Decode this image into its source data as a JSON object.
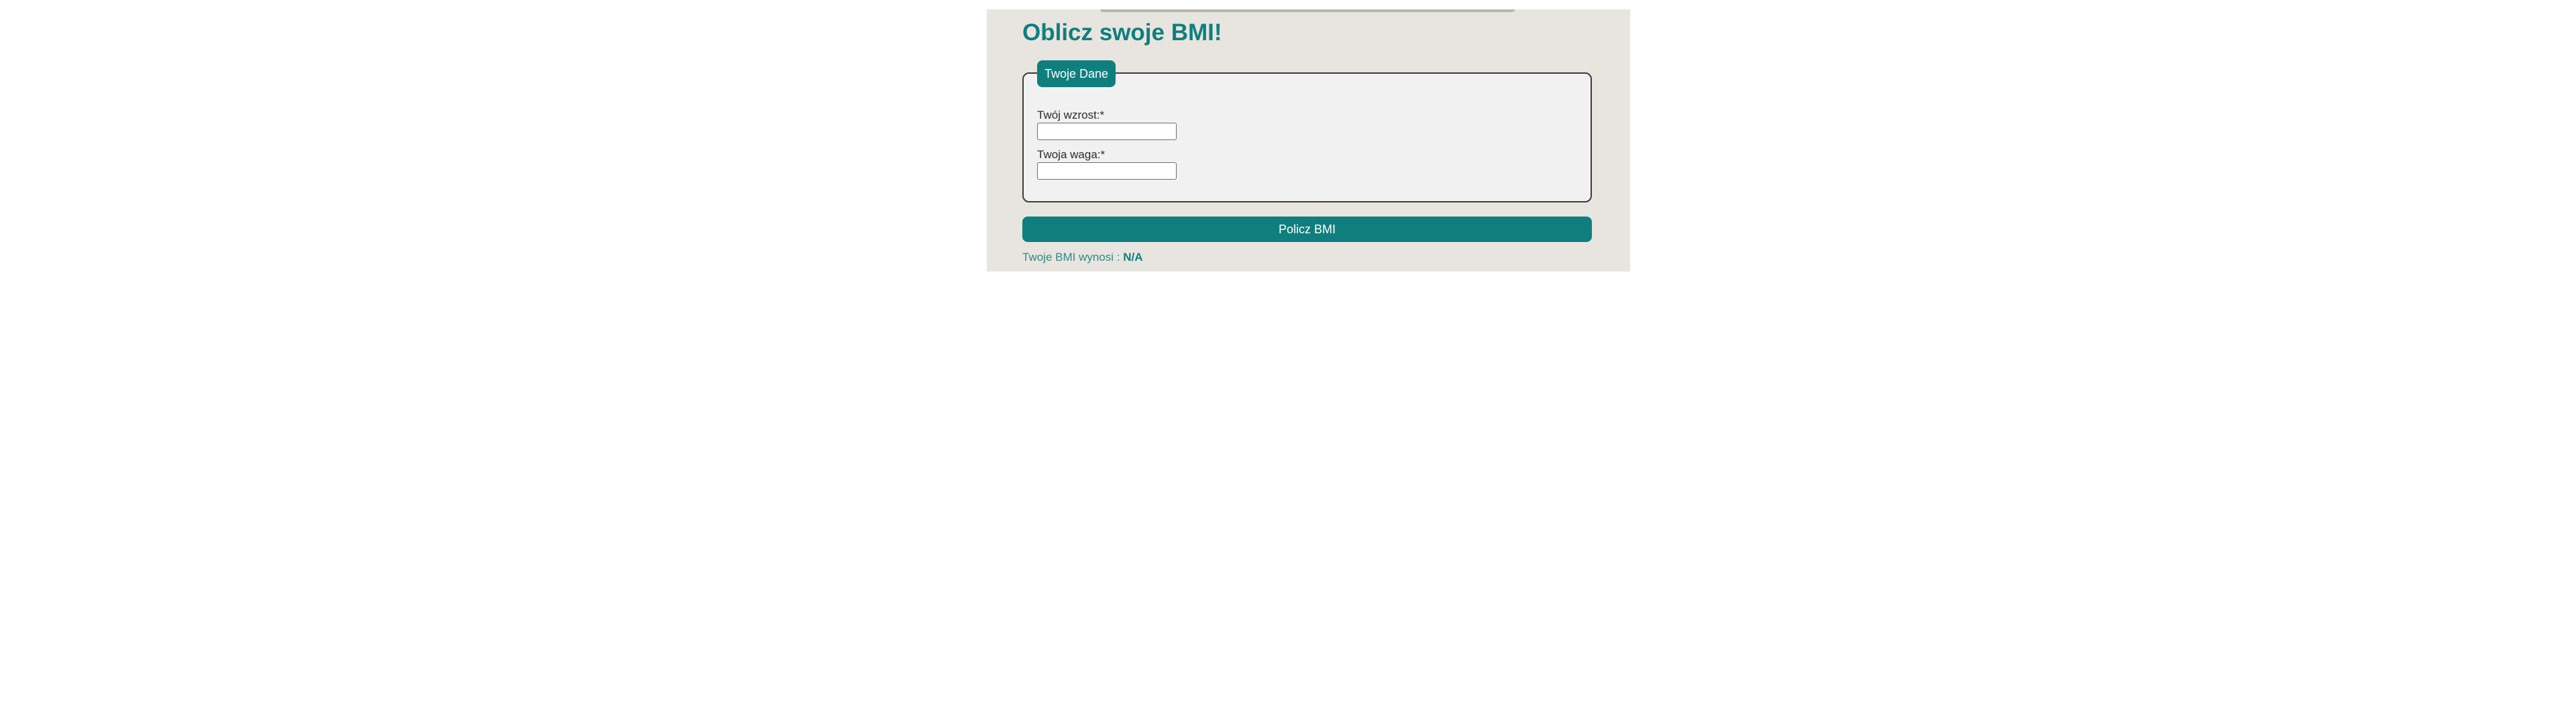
{
  "page": {
    "title": "Oblicz swoje BMI!"
  },
  "form": {
    "legend": "Twoje Dane",
    "height_field": {
      "label": "Twój wzrost:*",
      "value": ""
    },
    "weight_field": {
      "label": "Twoja waga:*",
      "value": ""
    },
    "submit_label": "Policz BMI"
  },
  "result": {
    "label": "Twoje BMI wynosi : ",
    "value": "N/A"
  },
  "colors": {
    "accent": "#0f7f7e",
    "panel_background": "#e8e4df",
    "fieldset_background": "#f1f1f1",
    "page_background": "#ffffff"
  }
}
